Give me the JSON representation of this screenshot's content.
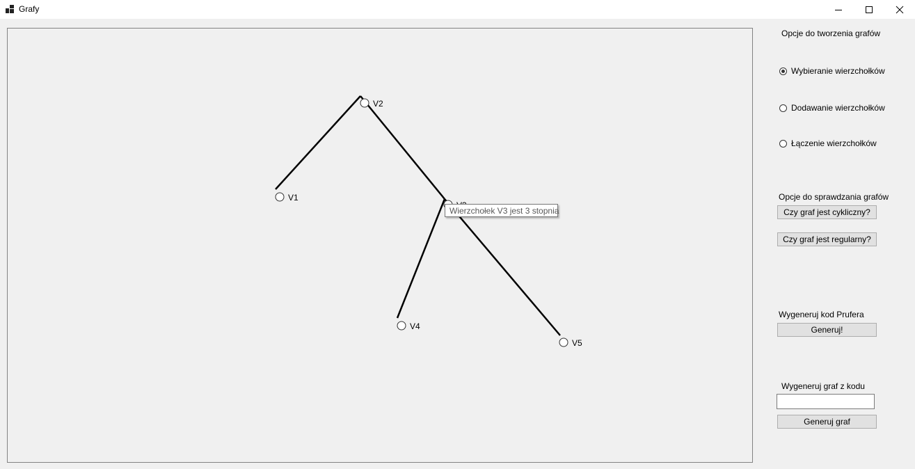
{
  "window": {
    "title": "Grafy",
    "icons": {
      "app": "app-icon",
      "minimize": "minimize-icon",
      "maximize": "maximize-icon",
      "close": "close-icon"
    }
  },
  "graph": {
    "vertices": [
      {
        "id": "V1",
        "label": "V1"
      },
      {
        "id": "V2",
        "label": "V2"
      },
      {
        "id": "V3",
        "label": "V3"
      },
      {
        "id": "V4",
        "label": "V4"
      },
      {
        "id": "V5",
        "label": "V5"
      }
    ],
    "edges": [
      [
        "V2",
        "V1"
      ],
      [
        "V2",
        "V3"
      ],
      [
        "V3",
        "V4"
      ],
      [
        "V3",
        "V5"
      ]
    ],
    "tooltip": "Wierzchołek V3 jest 3 stopnia"
  },
  "sidebar": {
    "create_title": "Opcje do tworzenia grafów",
    "modes": [
      {
        "label": "Wybieranie wierzchołków",
        "checked": true
      },
      {
        "label": "Dodawanie wierzchołków",
        "checked": false
      },
      {
        "label": "Łączenie wierzchołków",
        "checked": false
      }
    ],
    "check_title": "Opcje do sprawdzania grafów",
    "btn_cyclic": "Czy graf jest cykliczny?",
    "btn_regular": "Czy graf jest regularny?",
    "prufer_title": "Wygeneruj kod Prufera",
    "btn_generate": "Generuj!",
    "from_code_title": "Wygeneruj graf z kodu",
    "code_input_value": "",
    "btn_generate_graph": "Generuj graf"
  }
}
